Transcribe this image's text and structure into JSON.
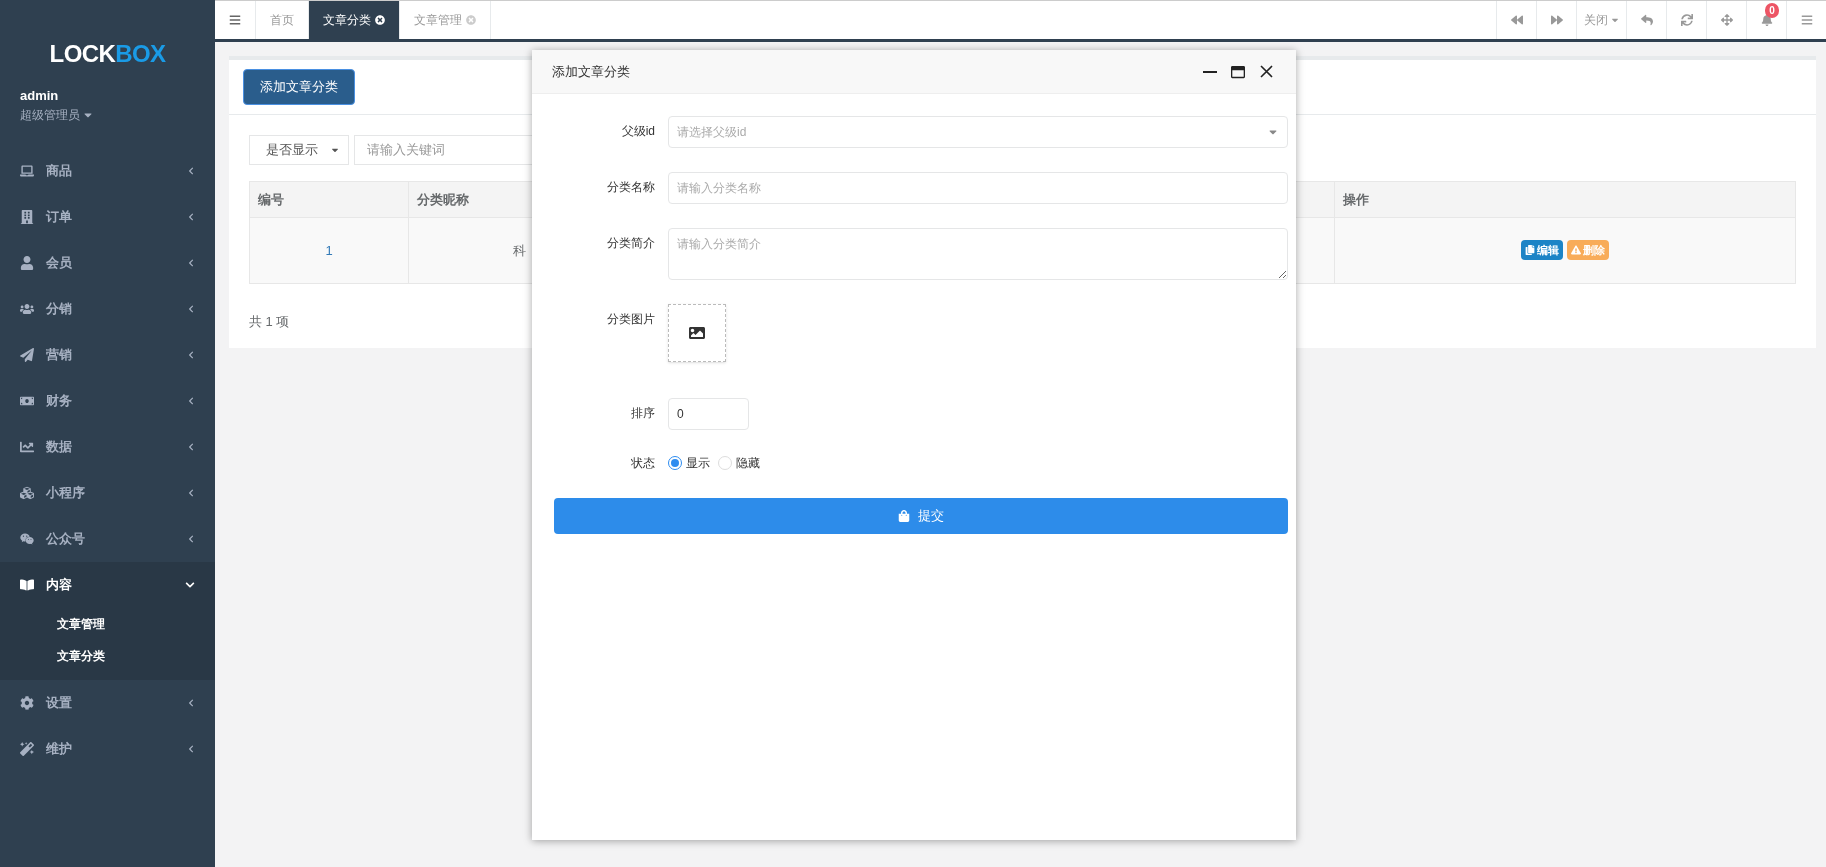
{
  "sidebar": {
    "logo": {
      "left": "LOCK",
      "right": "BOX"
    },
    "user": {
      "name": "admin",
      "role": "超级管理员"
    },
    "items": [
      {
        "label": "商品",
        "expanded": false
      },
      {
        "label": "订单",
        "expanded": false
      },
      {
        "label": "会员",
        "expanded": false
      },
      {
        "label": "分销",
        "expanded": false
      },
      {
        "label": "营销",
        "expanded": false
      },
      {
        "label": "财务",
        "expanded": false
      },
      {
        "label": "数据",
        "expanded": false
      },
      {
        "label": "小程序",
        "expanded": false
      },
      {
        "label": "公众号",
        "expanded": false
      },
      {
        "label": "内容",
        "expanded": true,
        "children": [
          {
            "label": "文章管理"
          },
          {
            "label": "文章分类"
          }
        ]
      },
      {
        "label": "设置",
        "expanded": false
      },
      {
        "label": "维护",
        "expanded": false
      }
    ]
  },
  "tabs": [
    {
      "label": "首页",
      "selected": false,
      "closable": false
    },
    {
      "label": "文章分类",
      "selected": true,
      "closable": true
    },
    {
      "label": "文章管理",
      "selected": false,
      "closable": true
    }
  ],
  "toolbar": {
    "close_menu": "关闭",
    "notification_count": "0"
  },
  "page": {
    "add_button": "添加文章分类",
    "filter": {
      "select": "是否显示",
      "search_placeholder": "请输入关键词"
    },
    "table": {
      "columns": [
        "编号",
        "分类昵称",
        "操作"
      ],
      "rows": [
        {
          "id": "1",
          "name": "科",
          "actions": [
            "编辑",
            "删除"
          ]
        }
      ]
    },
    "total": "共 1 项"
  },
  "dialog": {
    "title": "添加文章分类",
    "fields": [
      {
        "kind": "select",
        "label": "父级id",
        "placeholder": "请选择父级id"
      },
      {
        "kind": "text",
        "label": "分类名称",
        "placeholder": "请输入分类名称"
      },
      {
        "kind": "textarea",
        "label": "分类简介",
        "placeholder": "请输入分类简介"
      },
      {
        "kind": "image",
        "label": "分类图片"
      },
      {
        "kind": "number",
        "label": "排序",
        "value": "0"
      },
      {
        "kind": "radio",
        "label": "状态",
        "options": [
          {
            "label": "显示",
            "selected": true
          },
          {
            "label": "隐藏",
            "selected": false
          }
        ]
      }
    ],
    "submit": "提交"
  }
}
